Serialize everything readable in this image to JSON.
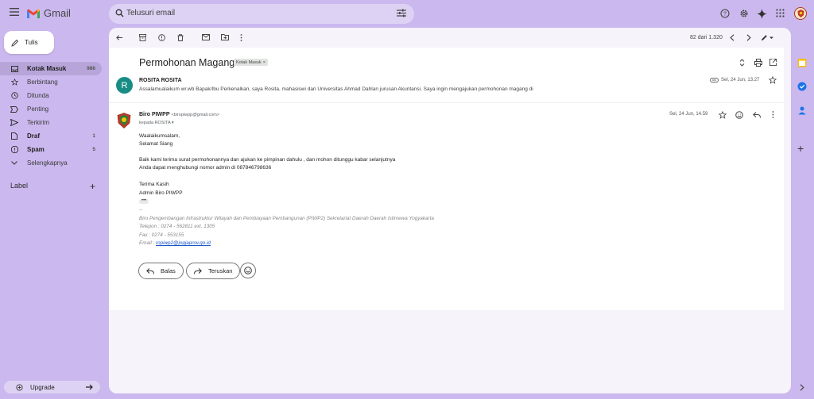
{
  "app": {
    "name": "Gmail"
  },
  "search": {
    "placeholder": "Telusuri email"
  },
  "compose": {
    "label": "Tulis"
  },
  "sidebar": {
    "items": [
      {
        "label": "Kotak Masuk",
        "count": "986",
        "icon": "inbox-icon"
      },
      {
        "label": "Berbintang",
        "count": "",
        "icon": "star-icon"
      },
      {
        "label": "Ditunda",
        "count": "",
        "icon": "clock-icon"
      },
      {
        "label": "Penting",
        "count": "",
        "icon": "label-important-icon"
      },
      {
        "label": "Terkirim",
        "count": "",
        "icon": "send-icon"
      },
      {
        "label": "Draf",
        "count": "1",
        "icon": "draft-icon"
      },
      {
        "label": "Spam",
        "count": "5",
        "icon": "spam-icon"
      },
      {
        "label": "Selengkapnya",
        "count": "",
        "icon": "chevron-down-icon"
      }
    ],
    "label_heading": "Label",
    "upgrade": "Upgrade"
  },
  "toolbar": {
    "pager": "82 dari 1.320"
  },
  "thread": {
    "subject": "Permohonan Magang",
    "chip": "Kotak Masuk",
    "messages": [
      {
        "avatar_letter": "R",
        "sender": "ROSITA ROSITA",
        "snippet": "Assalamualaikum wr.wb Bapak/Ibu Perkenalkan, saya Rosita, mahasiswi dari Universitas Ahmad Dahlan jurusan Akuntansi. Saya ingin mengajukan permohonan magang di",
        "date": "Sel, 24 Jun, 13.27"
      },
      {
        "sender": "Biro PIWPP",
        "email": "<biropiwpp@gmail.com>",
        "to": "kepada ROSITA",
        "date": "Sel, 24 Jun, 14.59",
        "body": [
          "Waalaikumsalam,",
          "Selamat Siang",
          "Baik kami terima surat permohonannya dan ajukan ke pimpinan dahulu , dan mohon ditunggu kabar selanjutnya",
          "Anda dapat menghubungi nomor admin di 087846798636",
          "Terima Kasih",
          "Admin Biro PIWPP"
        ],
        "signature": [
          "--",
          "Biro Pengembangan Infrastruktur Wilayah dan Pembiayaan Pembangunan (PIWP2) Sekretariat Daerah Daerah Istimewa Yogyakarta",
          "Telepon : 0274 - 562811 ext. 1305",
          "Fax : 0274 - 553155",
          "Email : "
        ],
        "signature_email": "ropiwp2@jogjaprov.go.id"
      }
    ]
  },
  "actions": {
    "reply": "Balas",
    "forward": "Teruskan"
  }
}
